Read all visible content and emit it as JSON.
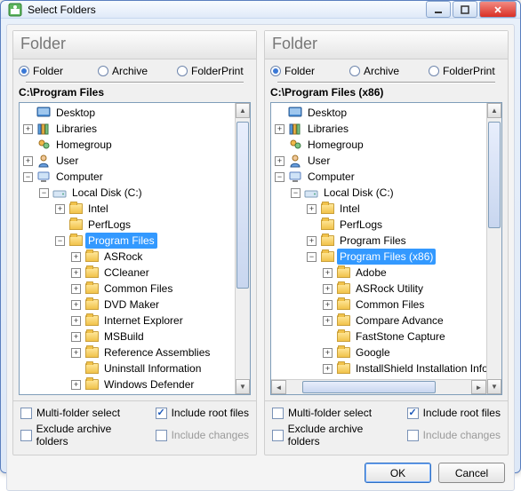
{
  "window": {
    "title": "Select Folders"
  },
  "panes": [
    {
      "header": "Folder",
      "radios": {
        "folder": "Folder",
        "archive": "Archive",
        "folderprint": "FolderPrint",
        "selected": "folder"
      },
      "path": "C:\\Program Files",
      "scrollbar": {
        "vertical": true,
        "horizontal": false,
        "thumbTop": 4,
        "thumbHeight": 188
      },
      "tree": [
        {
          "d": 0,
          "exp": "blank",
          "icon": "desktop",
          "label": "Desktop"
        },
        {
          "d": 0,
          "exp": "plus",
          "icon": "libraries",
          "label": "Libraries"
        },
        {
          "d": 0,
          "exp": "blank",
          "icon": "homegroup",
          "label": "Homegroup"
        },
        {
          "d": 0,
          "exp": "plus",
          "icon": "user",
          "label": "User"
        },
        {
          "d": 0,
          "exp": "minus",
          "icon": "computer",
          "label": "Computer"
        },
        {
          "d": 1,
          "exp": "minus",
          "icon": "drive",
          "label": "Local Disk (C:)"
        },
        {
          "d": 2,
          "exp": "plus",
          "icon": "folder",
          "label": "Intel"
        },
        {
          "d": 2,
          "exp": "blank",
          "icon": "folder",
          "label": "PerfLogs"
        },
        {
          "d": 2,
          "exp": "minus",
          "icon": "folder",
          "label": "Program Files",
          "selected": true
        },
        {
          "d": 3,
          "exp": "plus",
          "icon": "folder",
          "label": "ASRock"
        },
        {
          "d": 3,
          "exp": "plus",
          "icon": "folder",
          "label": "CCleaner"
        },
        {
          "d": 3,
          "exp": "plus",
          "icon": "folder",
          "label": "Common Files"
        },
        {
          "d": 3,
          "exp": "plus",
          "icon": "folder",
          "label": "DVD Maker"
        },
        {
          "d": 3,
          "exp": "plus",
          "icon": "folder",
          "label": "Internet Explorer"
        },
        {
          "d": 3,
          "exp": "plus",
          "icon": "folder",
          "label": "MSBuild"
        },
        {
          "d": 3,
          "exp": "plus",
          "icon": "folder",
          "label": "Reference Assemblies"
        },
        {
          "d": 3,
          "exp": "blank",
          "icon": "folder",
          "label": "Uninstall Information"
        },
        {
          "d": 3,
          "exp": "plus",
          "icon": "folder",
          "label": "Windows Defender",
          "cut": true
        }
      ],
      "checks": {
        "multi": {
          "label": "Multi-folder select",
          "checked": false,
          "enabled": true
        },
        "includeRoot": {
          "label": "Include root files",
          "checked": true,
          "enabled": true
        },
        "excludeArchive": {
          "label": "Exclude archive folders",
          "checked": false,
          "enabled": true
        },
        "includeChanges": {
          "label": "Include changes",
          "checked": false,
          "enabled": false
        }
      }
    },
    {
      "header": "Folder",
      "radios": {
        "folder": "Folder",
        "archive": "Archive",
        "folderprint": "FolderPrint",
        "selected": "folder"
      },
      "path": "C:\\Program Files (x86)",
      "scrollbar": {
        "vertical": true,
        "horizontal": true,
        "thumbTop": 4,
        "thumbHeight": 120,
        "hThumbLeft": 18,
        "hThumbWidth": 150
      },
      "tree": [
        {
          "d": 0,
          "exp": "blank",
          "icon": "desktop",
          "label": "Desktop"
        },
        {
          "d": 0,
          "exp": "plus",
          "icon": "libraries",
          "label": "Libraries"
        },
        {
          "d": 0,
          "exp": "blank",
          "icon": "homegroup",
          "label": "Homegroup"
        },
        {
          "d": 0,
          "exp": "plus",
          "icon": "user",
          "label": "User"
        },
        {
          "d": 0,
          "exp": "minus",
          "icon": "computer",
          "label": "Computer"
        },
        {
          "d": 1,
          "exp": "minus",
          "icon": "drive",
          "label": "Local Disk (C:)"
        },
        {
          "d": 2,
          "exp": "plus",
          "icon": "folder",
          "label": "Intel"
        },
        {
          "d": 2,
          "exp": "blank",
          "icon": "folder",
          "label": "PerfLogs"
        },
        {
          "d": 2,
          "exp": "plus",
          "icon": "folder",
          "label": "Program Files"
        },
        {
          "d": 2,
          "exp": "minus",
          "icon": "folder",
          "label": "Program Files (x86)",
          "selected": true
        },
        {
          "d": 3,
          "exp": "plus",
          "icon": "folder",
          "label": "Adobe"
        },
        {
          "d": 3,
          "exp": "plus",
          "icon": "folder",
          "label": "ASRock Utility"
        },
        {
          "d": 3,
          "exp": "plus",
          "icon": "folder",
          "label": "Common Files"
        },
        {
          "d": 3,
          "exp": "plus",
          "icon": "folder",
          "label": "Compare Advance"
        },
        {
          "d": 3,
          "exp": "blank",
          "icon": "folder",
          "label": "FastStone Capture"
        },
        {
          "d": 3,
          "exp": "plus",
          "icon": "folder",
          "label": "Google"
        },
        {
          "d": 3,
          "exp": "plus",
          "icon": "folder",
          "label": "InstallShield Installation Inform",
          "cut": true
        }
      ],
      "checks": {
        "multi": {
          "label": "Multi-folder select",
          "checked": false,
          "enabled": true
        },
        "includeRoot": {
          "label": "Include root files",
          "checked": true,
          "enabled": true
        },
        "excludeArchive": {
          "label": "Exclude archive folders",
          "checked": false,
          "enabled": true
        },
        "includeChanges": {
          "label": "Include changes",
          "checked": false,
          "enabled": false
        }
      }
    }
  ],
  "buttons": {
    "ok": "OK",
    "cancel": "Cancel"
  },
  "icons": {
    "desktop": "🖥️",
    "libraries": "📚",
    "homegroup": "👥",
    "user": "👤",
    "computer": "💻",
    "drive": "🖴",
    "folder": "folder"
  }
}
